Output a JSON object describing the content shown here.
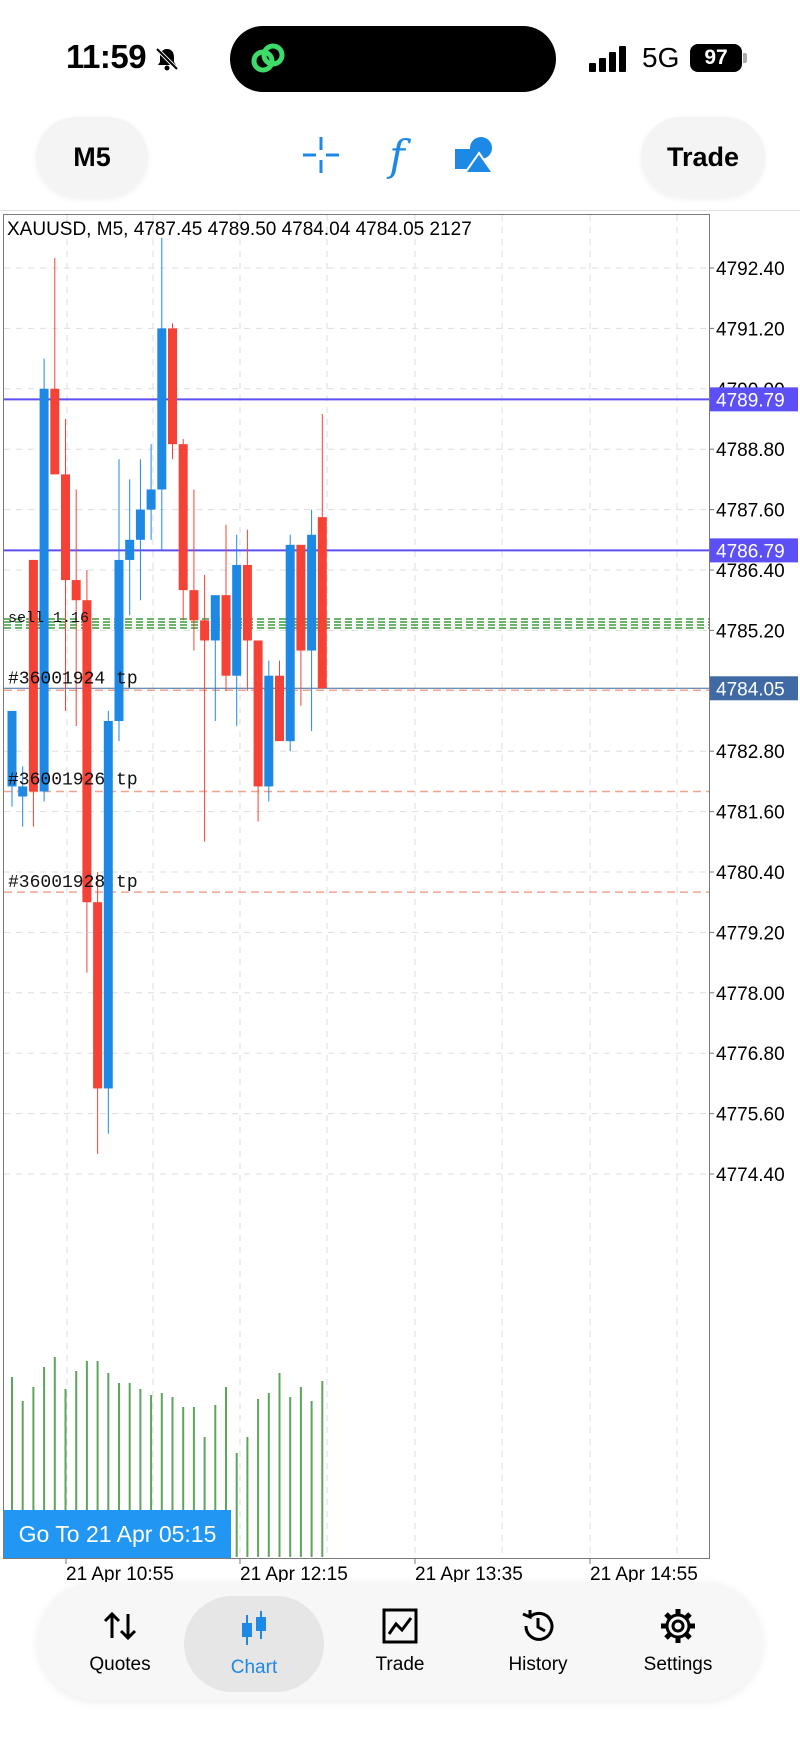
{
  "status_bar": {
    "time": "11:59",
    "network": "5G",
    "battery": "97",
    "icons": [
      "bell-slash-icon",
      "linked-rings-icon",
      "signal-bars-icon",
      "battery-icon"
    ]
  },
  "toolbar": {
    "timeframe": "M5",
    "trade_label": "Trade",
    "tools": [
      "crosshair-icon",
      "function-icon",
      "shapes-icon"
    ],
    "function_glyph": "f",
    "accent": "#1e88e5"
  },
  "chart": {
    "header": "XAUUSD, M5, 4787.45 4789.50 4784.04 4784.05 2127",
    "go_to_label": "Go To 21 Apr 05:15",
    "price_labels": [
      "4792.40",
      "4791.20",
      "4790.00",
      "4788.80",
      "4787.60",
      "4786.40",
      "4785.20",
      "4782.80",
      "4781.60",
      "4780.40",
      "4779.20",
      "4778.00",
      "4776.80",
      "4775.60",
      "4774.40"
    ],
    "time_labels": [
      "21 Apr 10:55",
      "21 Apr 12:15",
      "21 Apr 13:35",
      "21 Apr 14:55"
    ],
    "lines": [
      {
        "label": "4789.79",
        "color": "#5b4ff5",
        "kind": "level"
      },
      {
        "label": "4786.79",
        "color": "#5b4ff5",
        "kind": "level"
      },
      {
        "label": "4784.05",
        "color": "#3f6aa3",
        "kind": "bid"
      }
    ],
    "order_labels": [
      "#36001924 tp",
      "#36001926 tp",
      "#36001928 tp",
      "sell 1.16"
    ],
    "colors": {
      "bull": "#1e88e5",
      "bear": "#f44336",
      "volume": "#5ca65c",
      "grid": "#dddddd",
      "tp": "#f2a58e",
      "sl_green": "#3c9a3c"
    }
  },
  "chart_data": {
    "type": "candlestick",
    "title": "XAUUSD, M5, 4787.45 4789.50 4784.04 4784.05 2127",
    "ylim": [
      4773.0,
      4793.3
    ],
    "y_ticks": [
      4792.4,
      4791.2,
      4790.0,
      4788.8,
      4787.6,
      4786.4,
      4785.2,
      4782.8,
      4781.6,
      4780.4,
      4779.2,
      4778.0,
      4776.8,
      4775.6,
      4774.4
    ],
    "x_ticks": [
      "21 Apr 10:55",
      "21 Apr 12:15",
      "21 Apr 13:35",
      "21 Apr 14:55"
    ],
    "candles": [
      {
        "o": 4782.1,
        "h": 4783.6,
        "l": 4781.7,
        "c": 4783.6
      },
      {
        "o": 4781.9,
        "h": 4782.5,
        "l": 4781.3,
        "c": 4782.1
      },
      {
        "o": 4786.6,
        "h": 4786.6,
        "l": 4781.3,
        "c": 4782.0
      },
      {
        "o": 4782.0,
        "h": 4790.6,
        "l": 4781.8,
        "c": 4790.0
      },
      {
        "o": 4790.0,
        "h": 4792.6,
        "l": 4788.4,
        "c": 4788.3
      },
      {
        "o": 4788.3,
        "h": 4789.4,
        "l": 4783.6,
        "c": 4786.2
      },
      {
        "o": 4786.2,
        "h": 4788.0,
        "l": 4783.3,
        "c": 4785.8
      },
      {
        "o": 4785.8,
        "h": 4786.4,
        "l": 4778.4,
        "c": 4779.8
      },
      {
        "o": 4779.8,
        "h": 4780.4,
        "l": 4774.8,
        "c": 4776.1
      },
      {
        "o": 4776.1,
        "h": 4783.6,
        "l": 4775.2,
        "c": 4783.4
      },
      {
        "o": 4783.4,
        "h": 4788.6,
        "l": 4783.0,
        "c": 4786.6
      },
      {
        "o": 4786.6,
        "h": 4788.2,
        "l": 4785.5,
        "c": 4787.0
      },
      {
        "o": 4787.0,
        "h": 4788.6,
        "l": 4785.8,
        "c": 4787.6
      },
      {
        "o": 4787.6,
        "h": 4788.9,
        "l": 4787.0,
        "c": 4788.0
      },
      {
        "o": 4788.0,
        "h": 4793.0,
        "l": 4786.8,
        "c": 4791.2
      },
      {
        "o": 4791.2,
        "h": 4791.3,
        "l": 4788.6,
        "c": 4788.9
      },
      {
        "o": 4788.9,
        "h": 4789.0,
        "l": 4785.4,
        "c": 4786.0
      },
      {
        "o": 4786.0,
        "h": 4788.0,
        "l": 4784.8,
        "c": 4785.4
      },
      {
        "o": 4785.4,
        "h": 4786.3,
        "l": 4781.0,
        "c": 4785.0
      },
      {
        "o": 4785.0,
        "h": 4785.8,
        "l": 4783.4,
        "c": 4785.9
      },
      {
        "o": 4785.9,
        "h": 4787.3,
        "l": 4784.0,
        "c": 4784.3
      },
      {
        "o": 4784.3,
        "h": 4787.1,
        "l": 4783.3,
        "c": 4786.5
      },
      {
        "o": 4786.5,
        "h": 4787.2,
        "l": 4784.0,
        "c": 4785.0
      },
      {
        "o": 4785.0,
        "h": 4785.0,
        "l": 4781.4,
        "c": 4782.1
      },
      {
        "o": 4782.1,
        "h": 4784.6,
        "l": 4781.8,
        "c": 4784.3
      },
      {
        "o": 4784.3,
        "h": 4784.6,
        "l": 4783.1,
        "c": 4783.0
      },
      {
        "o": 4783.0,
        "h": 4787.1,
        "l": 4782.8,
        "c": 4786.9
      },
      {
        "o": 4786.9,
        "h": 4786.9,
        "l": 4783.7,
        "c": 4784.8
      },
      {
        "o": 4784.8,
        "h": 4787.6,
        "l": 4783.2,
        "c": 4787.1
      },
      {
        "o": 4787.45,
        "h": 4789.5,
        "l": 4784.04,
        "c": 4784.05
      }
    ],
    "volume_rel": [
      0.9,
      0.78,
      0.85,
      0.95,
      1.0,
      0.84,
      0.93,
      0.98,
      0.98,
      0.92,
      0.87,
      0.87,
      0.84,
      0.81,
      0.82,
      0.8,
      0.75,
      0.75,
      0.6,
      0.76,
      0.85,
      0.52,
      0.6,
      0.79,
      0.82,
      0.92,
      0.8,
      0.85,
      0.78,
      0.88
    ],
    "levels": [
      4789.79,
      4786.79,
      4784.05
    ],
    "tp_levels": [
      4784.05,
      4782.0,
      4780.0
    ],
    "grid": true
  },
  "nav": {
    "items": [
      {
        "label": "Quotes",
        "icon": "arrows-updown-icon"
      },
      {
        "label": "Chart",
        "icon": "candlestick-icon"
      },
      {
        "label": "Trade",
        "icon": "line-chart-icon"
      },
      {
        "label": "History",
        "icon": "history-icon"
      },
      {
        "label": "Settings",
        "icon": "gear-icon"
      }
    ],
    "active": "Chart"
  }
}
